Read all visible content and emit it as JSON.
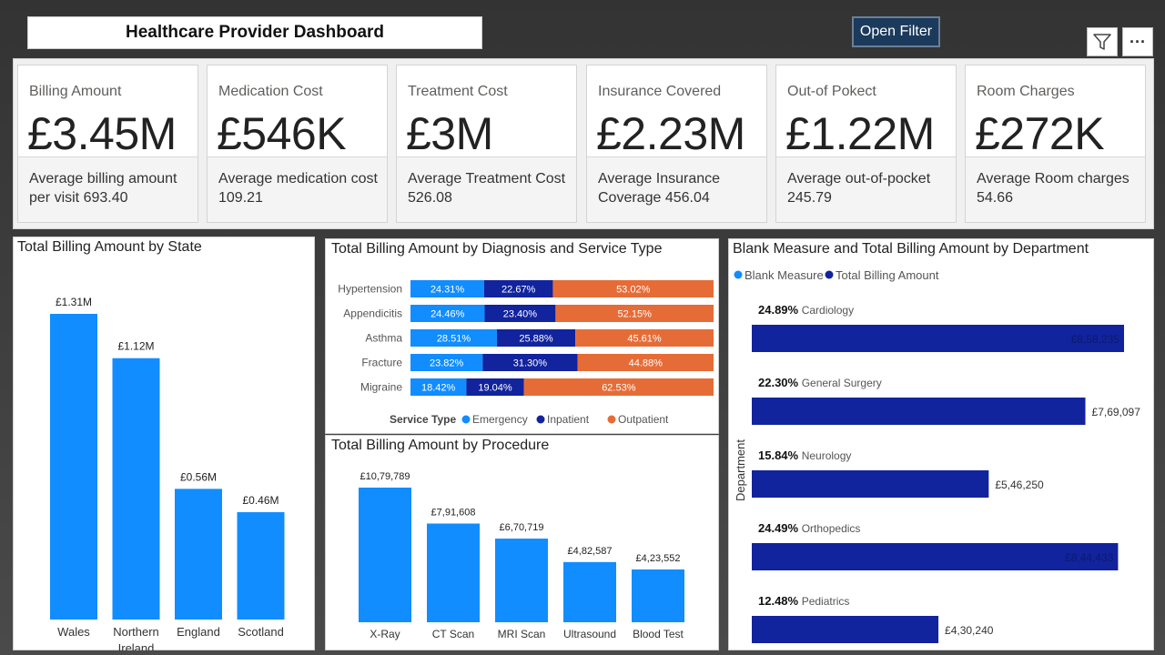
{
  "header": {
    "title": "Healthcare Provider Dashboard",
    "filter_label": "Open Filter",
    "more_label": "···"
  },
  "kpis": [
    {
      "label": "Billing Amount",
      "value": "£3.45M",
      "sub": "Average billing amount per visit 693.40"
    },
    {
      "label": "Medication Cost",
      "value": "£546K",
      "sub": "Average medication cost 109.21"
    },
    {
      "label": "Treatment Cost",
      "value": "£3M",
      "sub": "Average Treatment Cost 526.08"
    },
    {
      "label": "Insurance Covered",
      "value": "£2.23M",
      "sub": "Average Insurance Coverage 456.04"
    },
    {
      "label": "Out-of Pokect",
      "value": "£1.22M",
      "sub": "Average out-of-pocket 245.79"
    },
    {
      "label": "Room Charges",
      "value": "£272K",
      "sub": "Average Room charges 54.66"
    }
  ],
  "chart_data": [
    {
      "id": "state",
      "type": "bar",
      "title": "Total Billing Amount by State",
      "categories": [
        "Wales",
        "Northern Ireland",
        "England",
        "Scotland"
      ],
      "category_lines": [
        [
          "Wales"
        ],
        [
          "Northern",
          "Ireland"
        ],
        [
          "England"
        ],
        [
          "Scotland"
        ]
      ],
      "values": [
        1.31,
        1.12,
        0.56,
        0.46
      ],
      "labels": [
        "£1.31M",
        "£1.12M",
        "£0.56M",
        "£0.46M"
      ],
      "color": "#118dff",
      "ylim": [
        0,
        1.31
      ]
    },
    {
      "id": "diagnosis",
      "type": "bar",
      "orientation": "horizontal-100%-stacked",
      "title": "Total Billing Amount by Diagnosis and Service Type",
      "categories": [
        "Hypertension",
        "Appendicitis",
        "Asthma",
        "Fracture",
        "Migraine"
      ],
      "legend_title": "Service Type",
      "series": [
        {
          "name": "Emergency",
          "color": "#118dff",
          "values": [
            24.31,
            24.46,
            28.51,
            23.82,
            18.42
          ],
          "labels": [
            "24.31%",
            "24.46%",
            "28.51%",
            "23.82%",
            "18.42%"
          ]
        },
        {
          "name": "Inpatient",
          "color": "#12239e",
          "values": [
            22.67,
            23.4,
            25.88,
            31.3,
            19.04
          ],
          "labels": [
            "22.67%",
            "23.40%",
            "25.88%",
            "31.30%",
            "19.04%"
          ]
        },
        {
          "name": "Outpatient",
          "color": "#e66c37",
          "values": [
            53.02,
            52.15,
            45.61,
            44.88,
            62.53
          ],
          "labels": [
            "53.02%",
            "52.15%",
            "45.61%",
            "44.88%",
            "62.53%"
          ]
        }
      ]
    },
    {
      "id": "procedure",
      "type": "bar",
      "title": "Total Billing Amount by Procedure",
      "categories": [
        "X-Ray",
        "CT Scan",
        "MRI Scan",
        "Ultrasound",
        "Blood Test"
      ],
      "values": [
        1079789,
        791608,
        670719,
        482587,
        423552
      ],
      "labels": [
        "£10,79,789",
        "£7,91,608",
        "£6,70,719",
        "£4,82,587",
        "£4,23,552"
      ],
      "color": "#118dff",
      "ylim": [
        0,
        1079789
      ]
    },
    {
      "id": "department",
      "type": "bar",
      "orientation": "horizontal",
      "title": "Blank Measure and Total Billing Amount by Department",
      "ylabel": "Department",
      "legend": [
        {
          "name": "Blank Measure",
          "color": "#118dff"
        },
        {
          "name": "Total Billing Amount",
          "color": "#12239e"
        }
      ],
      "categories": [
        "Cardiology",
        "General Surgery",
        "Neurology",
        "Orthopedics",
        "Pediatrics"
      ],
      "percents": [
        "24.89%",
        "22.30%",
        "15.84%",
        "24.49%",
        "12.48%"
      ],
      "values": [
        858235,
        769097,
        546250,
        844433,
        430240
      ],
      "labels": [
        "£8,58,235",
        "£7,69,097",
        "£5,46,250",
        "£8,44,433",
        "£4,30,240"
      ],
      "color": "#12239e",
      "xlim": [
        0,
        858235
      ]
    }
  ]
}
